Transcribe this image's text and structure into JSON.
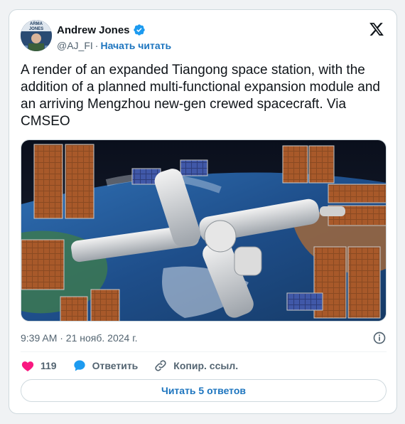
{
  "author": {
    "display_name": "Andrew Jones",
    "handle": "@AJ_FI",
    "separator": "·",
    "follow_label": "Начать читать",
    "verified": true,
    "avatar_text": "ARMA JONES"
  },
  "tweet": {
    "text": "A render of an expanded Tiangong space station, with the addition of a planned multi-functional expansion module and an arriving Mengzhou new-gen crewed spacecraft. Via CMSEO",
    "timestamp": "9:39 AM · 21 нояб. 2024 г."
  },
  "actions": {
    "like_count": "119",
    "reply_label": "Ответить",
    "copy_link_label": "Копир. ссыл."
  },
  "read_replies_label": "Читать 5 ответов",
  "colors": {
    "accent": "#1d9bf0",
    "like": "#f91880",
    "link": "#1d75bf",
    "muted": "#536471"
  },
  "icons": [
    "verified-badge-icon",
    "x-logo-icon",
    "info-icon",
    "heart-icon",
    "reply-bubble-icon",
    "link-icon"
  ]
}
